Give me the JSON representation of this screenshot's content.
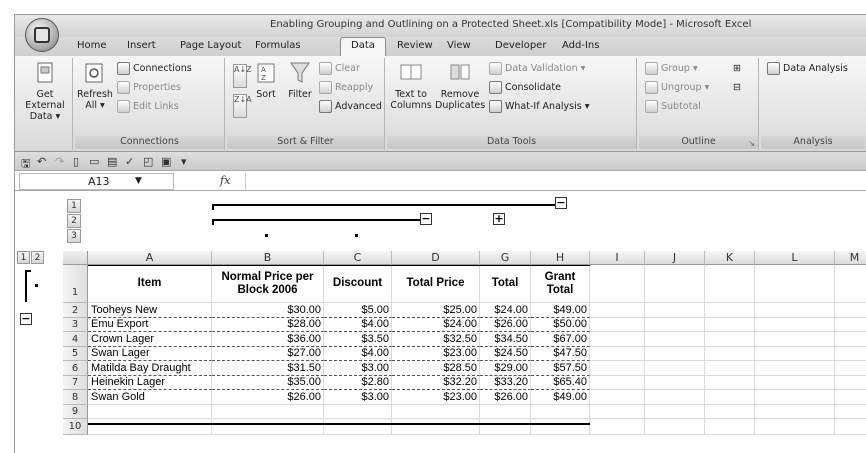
{
  "window": {
    "title": "Enabling Grouping and Outlining on a Protected Sheet.xls  [Compatibility Mode] - Microsoft Excel"
  },
  "tabs": [
    "Home",
    "Insert",
    "Page Layout",
    "Formulas",
    "Data",
    "Review",
    "View",
    "Developer",
    "Add-Ins"
  ],
  "active_tab": "Data",
  "ribbon": {
    "get_external_data": {
      "line1": "Get External",
      "line2": "Data ▾"
    },
    "connections_group": {
      "refresh": {
        "line1": "Refresh",
        "line2": "All ▾"
      },
      "connections": "Connections",
      "properties": "Properties",
      "edit_links": "Edit Links",
      "label": "Connections"
    },
    "sort_filter_group": {
      "sort_az": "A↓Z",
      "sort_za": "Z↓A",
      "sort": "Sort",
      "filter": "Filter",
      "clear": "Clear",
      "reapply": "Reapply",
      "advanced": "Advanced",
      "label": "Sort & Filter"
    },
    "data_tools_group": {
      "text_to_columns": {
        "line1": "Text to",
        "line2": "Columns"
      },
      "remove_duplicates": {
        "line1": "Remove",
        "line2": "Duplicates"
      },
      "data_validation": "Data Validation ▾",
      "consolidate": "Consolidate",
      "what_if": "What-If Analysis ▾",
      "label": "Data Tools"
    },
    "outline_group": {
      "group": "Group ▾",
      "ungroup": "Ungroup ▾",
      "subtotal": "Subtotal",
      "label": "Outline"
    },
    "analysis_group": {
      "data_analysis": "Data Analysis",
      "label": "Analysis"
    }
  },
  "formula_bar": {
    "name_box": "A13",
    "fx": "fx",
    "formula": ""
  },
  "outline": {
    "row_levels": [
      "1",
      "2"
    ],
    "col_levels": [
      "1",
      "2",
      "3"
    ],
    "collapse": "−",
    "expand": "+"
  },
  "columns": [
    "A",
    "B",
    "C",
    "D",
    "G",
    "H",
    "I",
    "J",
    "K",
    "L",
    "M"
  ],
  "rows": [
    "1",
    "2",
    "3",
    "4",
    "5",
    "6",
    "7",
    "8",
    "9",
    "10"
  ],
  "table": {
    "headers": [
      "Item",
      "Normal Price per Block 2006",
      "Discount",
      "Total Price",
      "Total",
      "Grant Total"
    ],
    "data": [
      [
        "Tooheys New",
        "$30.00",
        "$5.00",
        "$25.00",
        "$24.00",
        "$49.00"
      ],
      [
        "Emu Export",
        "$28.00",
        "$4.00",
        "$24.00",
        "$26.00",
        "$50.00"
      ],
      [
        "Crown Lager",
        "$36.00",
        "$3.50",
        "$32.50",
        "$34.50",
        "$67.00"
      ],
      [
        "Swan Lager",
        "$27.00",
        "$4.00",
        "$23.00",
        "$24.50",
        "$47.50"
      ],
      [
        "Matilda Bay Draught",
        "$31.50",
        "$3.00",
        "$28.50",
        "$29.00",
        "$57.50"
      ],
      [
        "Heinekin Lager",
        "$35.00",
        "$2.80",
        "$32.20",
        "$33.20",
        "$65.40"
      ],
      [
        "Swan Gold",
        "$26.00",
        "$3.00",
        "$23.00",
        "$26.00",
        "$49.00"
      ]
    ]
  }
}
